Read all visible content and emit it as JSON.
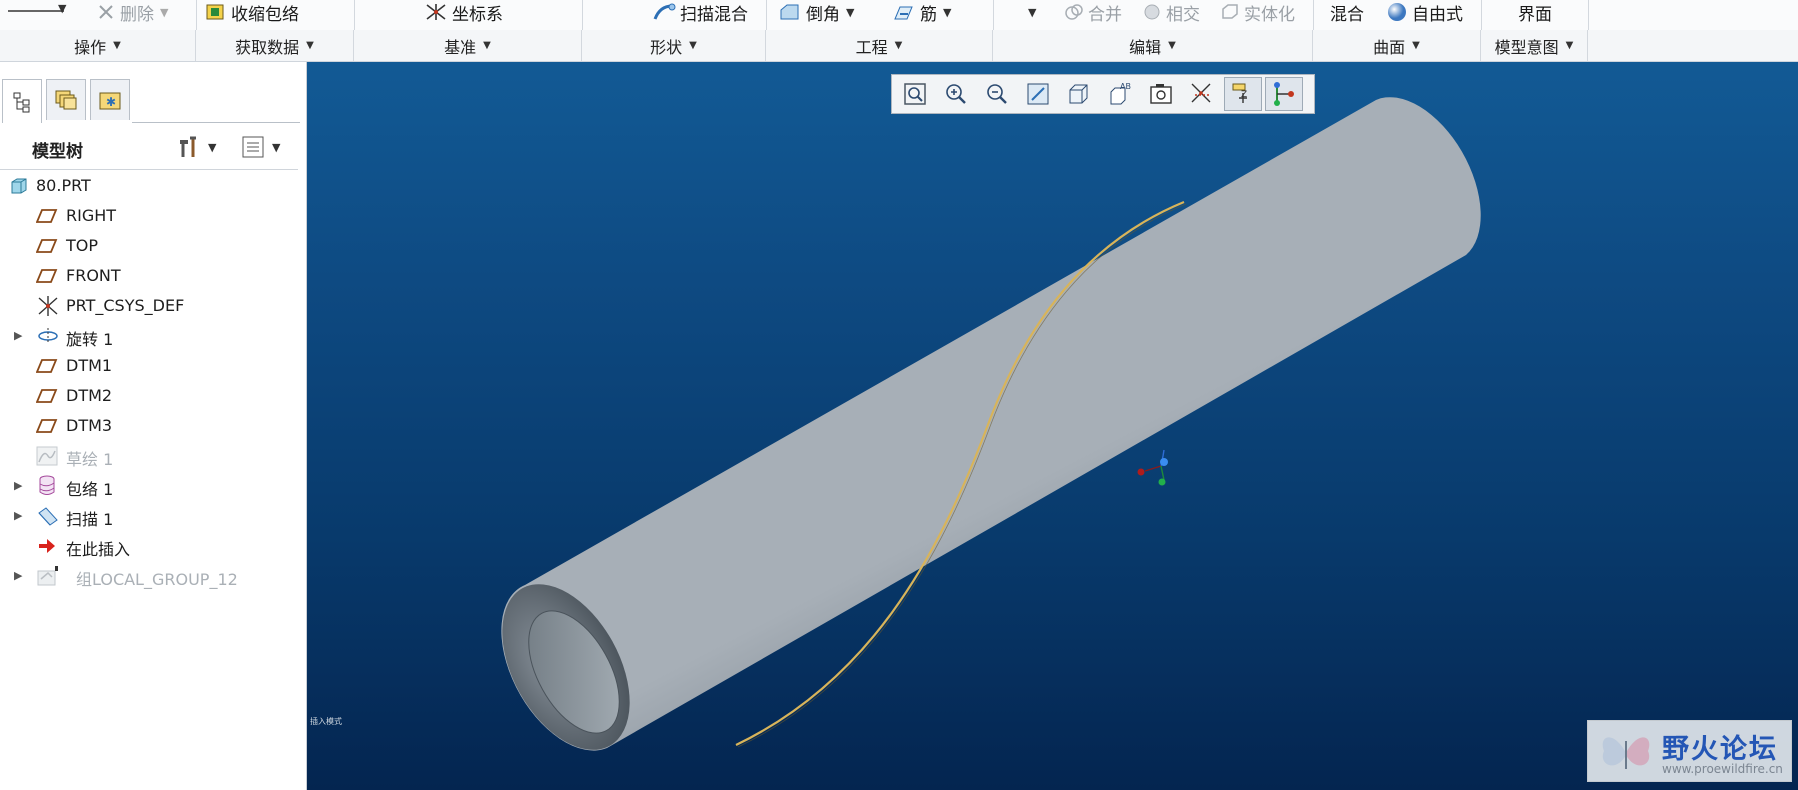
{
  "ribbon": {
    "top_items": [
      {
        "label": "",
        "key": "op-menu"
      },
      {
        "label": "删除",
        "key": "delete",
        "disabled": true
      },
      {
        "label": "收缩包络",
        "key": "shrinkwrap"
      },
      {
        "label": "坐标系",
        "key": "csys"
      },
      {
        "label": "扫描混合",
        "key": "swept-blend"
      },
      {
        "label": "倒角",
        "key": "chamfer"
      },
      {
        "label": "筋",
        "key": "rib"
      },
      {
        "label": "合并",
        "key": "merge",
        "disabled": true
      },
      {
        "label": "相交",
        "key": "intersect",
        "disabled": true
      },
      {
        "label": "实体化",
        "key": "solidify",
        "disabled": true
      },
      {
        "label": "混合",
        "key": "blend"
      },
      {
        "label": "自由式",
        "key": "freestyle"
      },
      {
        "label": "界面",
        "key": "interface"
      }
    ],
    "groups": [
      "操作",
      "获取数据",
      "基准",
      "形状",
      "工程",
      "编辑",
      "曲面",
      "模型意图"
    ]
  },
  "left_panel": {
    "tabs": [
      "model-tree-tab",
      "layers-tab",
      "favorites-tab"
    ],
    "title": "模型树",
    "tree": [
      {
        "label": "80.PRT",
        "icon": "part-icon",
        "expander": false,
        "dim": false,
        "indent": 0
      },
      {
        "label": "RIGHT",
        "icon": "datum-plane-icon",
        "expander": false,
        "dim": false,
        "indent": 1
      },
      {
        "label": "TOP",
        "icon": "datum-plane-icon",
        "expander": false,
        "dim": false,
        "indent": 1
      },
      {
        "label": "FRONT",
        "icon": "datum-plane-icon",
        "expander": false,
        "dim": false,
        "indent": 1
      },
      {
        "label": "PRT_CSYS_DEF",
        "icon": "coordinate-system-icon",
        "expander": false,
        "dim": false,
        "indent": 1
      },
      {
        "label": "旋转 1",
        "icon": "revolve-icon",
        "expander": true,
        "dim": false,
        "indent": 1
      },
      {
        "label": "DTM1",
        "icon": "datum-plane-icon",
        "expander": false,
        "dim": false,
        "indent": 1
      },
      {
        "label": "DTM2",
        "icon": "datum-plane-icon",
        "expander": false,
        "dim": false,
        "indent": 1
      },
      {
        "label": "DTM3",
        "icon": "datum-plane-icon",
        "expander": false,
        "dim": false,
        "indent": 1
      },
      {
        "label": "草绘 1",
        "icon": "sketch-icon",
        "expander": false,
        "dim": true,
        "indent": 1
      },
      {
        "label": "包络 1",
        "icon": "wrap-icon",
        "expander": true,
        "dim": false,
        "indent": 1
      },
      {
        "label": "扫描 1",
        "icon": "sweep-icon",
        "expander": true,
        "dim": false,
        "indent": 1
      },
      {
        "label": "在此插入",
        "icon": "insert-here-icon",
        "expander": false,
        "dim": false,
        "indent": 1
      },
      {
        "label": "组LOCAL_GROUP_12",
        "icon": "group-icon",
        "expander": true,
        "dim": true,
        "indent": 1
      }
    ]
  },
  "view_toolbar": [
    {
      "name": "refit-icon",
      "on": false
    },
    {
      "name": "zoom-in-icon",
      "on": false
    },
    {
      "name": "zoom-out-icon",
      "on": false
    },
    {
      "name": "repaint-icon",
      "on": false
    },
    {
      "name": "display-style-icon",
      "on": false
    },
    {
      "name": "saved-orientations-icon",
      "on": false
    },
    {
      "name": "view-manager-icon",
      "on": false
    },
    {
      "name": "datum-display-icon",
      "on": false
    },
    {
      "name": "spin-center-icon",
      "on": true
    },
    {
      "name": "annotation-display-icon",
      "on": true
    }
  ],
  "viewport": {
    "caption": "插入模式",
    "watermark_title": "野火论坛",
    "watermark_url": "www.proewildfire.cn"
  },
  "colors": {
    "viewport_top": "#125a95",
    "viewport_bottom": "#042550",
    "tube": "#8a949e",
    "helix": "#d8b45a"
  }
}
